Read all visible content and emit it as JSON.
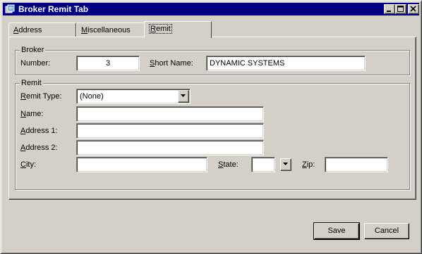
{
  "window": {
    "title": "Broker Remit Tab"
  },
  "tabs": [
    {
      "label_first": "A",
      "label_rest": "ddress"
    },
    {
      "label_first": "M",
      "label_rest": "iscellaneous"
    },
    {
      "label_first": "R",
      "label_rest": "emit"
    }
  ],
  "broker": {
    "group_label": "Broker",
    "number_label": "Number:",
    "number_value": "3",
    "short_name_label_first": "S",
    "short_name_label_rest": "hort Name:",
    "short_name_value": "DYNAMIC SYSTEMS"
  },
  "remit": {
    "group_label": "Remit",
    "type_label_first": "R",
    "type_label_rest": "emit Type:",
    "type_value": "(None)",
    "name_label_first": "N",
    "name_label_rest": "ame:",
    "name_value": "",
    "address1_label_first": "A",
    "address1_label_rest": "ddress 1:",
    "address1_value": "",
    "address2_label_first": "A",
    "address2_label_rest": "ddress 2:",
    "address2_value": "",
    "city_label_first": "C",
    "city_label_rest": "ity:",
    "city_value": "",
    "state_label_first": "S",
    "state_label_rest": "tate:",
    "state_value": "",
    "zip_label_first": "Z",
    "zip_label_rest": "ip:",
    "zip_value": ""
  },
  "buttons": {
    "save": "Save",
    "cancel": "Cancel"
  },
  "colors": {
    "title_bar": "#000080",
    "face": "#d4d0c8"
  }
}
